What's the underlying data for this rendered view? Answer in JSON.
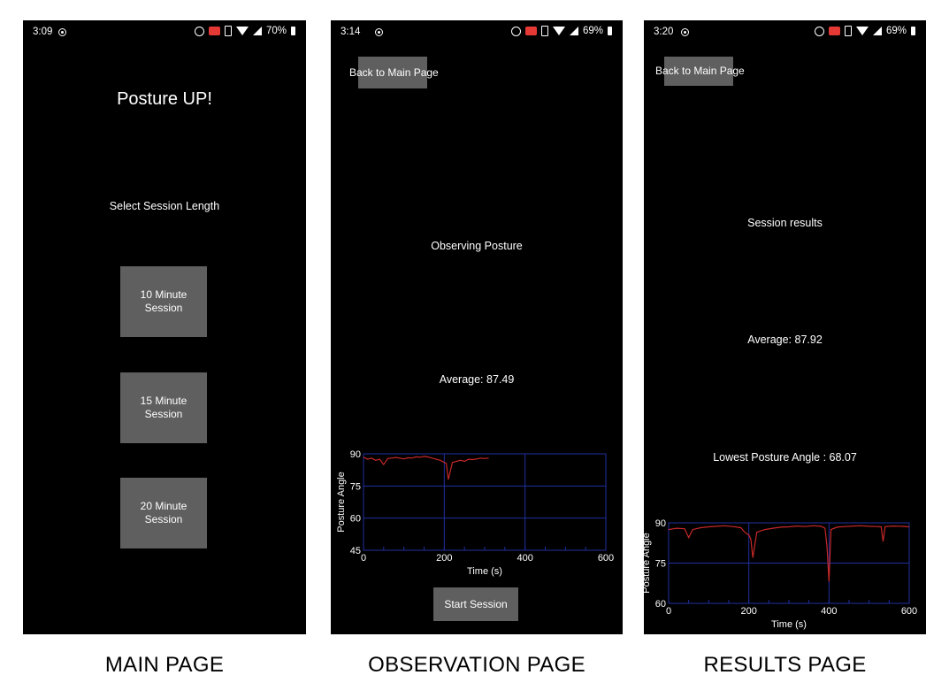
{
  "main_page": {
    "status": {
      "time": "3:09",
      "battery": "70%"
    },
    "app_title": "Posture UP!",
    "select_label": "Select Session Length",
    "buttons": [
      {
        "line1": "10 Minute",
        "line2": "Session"
      },
      {
        "line1": "15 Minute",
        "line2": "Session"
      },
      {
        "line1": "20 Minute",
        "line2": "Session"
      }
    ],
    "caption": "MAIN PAGE"
  },
  "observation_page": {
    "status": {
      "time": "3:14",
      "battery": "69%"
    },
    "back_label": "Back to Main Page",
    "observing_label": "Observing Posture",
    "average_label": "Average: 87.49",
    "start_label": "Start Session",
    "caption": "OBSERVATION PAGE"
  },
  "results_page": {
    "status": {
      "time": "3:20",
      "battery": "69%"
    },
    "back_label": "Back to Main Page",
    "results_label": "Session results",
    "average_label": "Average: 87.92",
    "lowest_label": "Lowest Posture Angle : 68.07",
    "caption": "RESULTS PAGE"
  },
  "icons": [
    "circle-dot-icon",
    "alarm-icon",
    "cast-icon",
    "vibrate-icon",
    "wifi-icon",
    "signal-icon",
    "battery-icon"
  ],
  "colors": {
    "screen_bg": "#000000",
    "button_bg": "#5f5f5f",
    "grid": "#1f2fa0",
    "series": "#c62828"
  },
  "chart_data": [
    {
      "type": "line",
      "xlabel": "Time (s)",
      "ylabel": "Posture Angle",
      "xlim": [
        0,
        600
      ],
      "ylim": [
        45,
        90
      ],
      "x_ticks": [
        0,
        200,
        400,
        600
      ],
      "y_ticks": [
        45,
        60,
        75,
        90
      ],
      "grid": true,
      "series": [
        {
          "x": [
            0,
            10,
            20,
            30,
            40,
            50,
            60,
            70,
            80,
            90,
            100,
            110,
            120,
            130,
            140,
            150,
            160,
            170,
            180,
            190,
            200,
            205,
            210,
            220,
            230,
            240,
            250,
            260,
            270,
            280,
            290,
            300,
            310
          ],
          "y": [
            88.5,
            87.5,
            88,
            87,
            87.5,
            85,
            87.8,
            88,
            88.3,
            88,
            87.6,
            88.2,
            88,
            88.6,
            88.4,
            88.8,
            88.5,
            88,
            87.5,
            87,
            86,
            85.5,
            78,
            86,
            86.5,
            87,
            86.5,
            87.5,
            87.3,
            87.6,
            88,
            87.8,
            88
          ]
        }
      ]
    },
    {
      "type": "line",
      "xlabel": "Time (s)",
      "ylabel": "Posture Angle",
      "xlim": [
        0,
        600
      ],
      "ylim": [
        60,
        90
      ],
      "x_ticks": [
        0,
        200,
        400,
        600
      ],
      "y_ticks": [
        60,
        75,
        90
      ],
      "grid": true,
      "series": [
        {
          "x": [
            0,
            20,
            40,
            50,
            60,
            80,
            100,
            120,
            140,
            160,
            180,
            190,
            200,
            205,
            210,
            220,
            240,
            260,
            280,
            300,
            320,
            340,
            360,
            380,
            390,
            395,
            400,
            405,
            420,
            440,
            460,
            480,
            500,
            520,
            530,
            535,
            540,
            560,
            580,
            600
          ],
          "y": [
            87.5,
            88,
            87.8,
            84.5,
            87.5,
            88.2,
            88.5,
            88.7,
            88.9,
            88.6,
            88.2,
            86.5,
            85.5,
            84,
            77,
            86.5,
            87.5,
            88,
            88.4,
            88.5,
            88.8,
            88.6,
            88.9,
            88.7,
            88,
            81,
            68.07,
            87.5,
            88.4,
            88.6,
            88.8,
            88.9,
            88.7,
            88.6,
            88.5,
            83,
            88.6,
            88.8,
            88.7,
            88.5
          ]
        }
      ]
    }
  ]
}
